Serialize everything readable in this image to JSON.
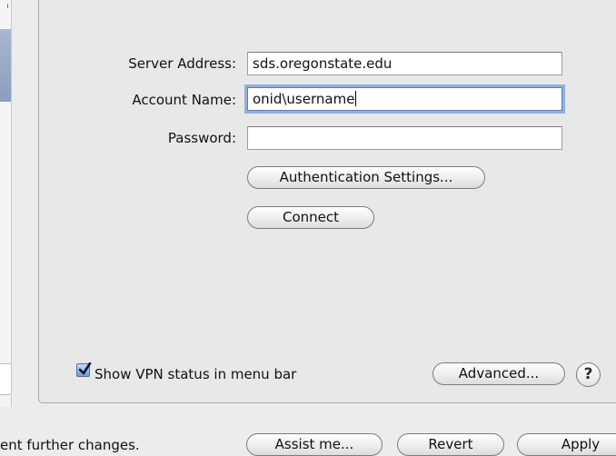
{
  "form": {
    "server_label": "Server Address:",
    "server_value": "sds.oregonstate.edu",
    "account_label": "Account Name:",
    "account_value": "onid\\username",
    "password_label": "Password:",
    "password_value": ""
  },
  "buttons": {
    "auth_settings": "Authentication Settings...",
    "connect": "Connect",
    "advanced": "Advanced...",
    "help": "?",
    "assist": "Assist me...",
    "revert": "Revert",
    "apply": "Apply"
  },
  "status": {
    "show_vpn_label": "Show VPN status in menu bar",
    "show_vpn_checked": true
  },
  "footer": {
    "lock_text": "ent further changes."
  }
}
